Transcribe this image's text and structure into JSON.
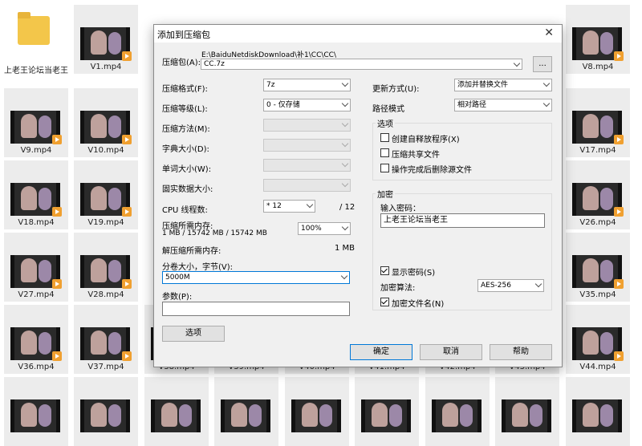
{
  "files": {
    "folder": "上老王论坛当老王",
    "videos": [
      "V1.mp4",
      "V8.mp4",
      "V9.mp4",
      "V10.mp4",
      "V17.mp4",
      "V18.mp4",
      "V19.mp4",
      "V26.mp4",
      "V27.mp4",
      "V28.mp4",
      "V35.mp4",
      "V36.mp4",
      "V37.mp4",
      "V38.mp4",
      "V39.mp4",
      "V40.mp4",
      "V41.mp4",
      "V42.mp4",
      "V43.mp4",
      "V44.mp4"
    ]
  },
  "dialog": {
    "title": "添加到压缩包",
    "archive_label": "压缩包(A):",
    "archive_path": "E:\\BaiduNetdiskDownload\\补1\\CC\\CC\\",
    "archive_name": "CC.7z",
    "browse_label": "...",
    "format_label": "压缩格式(F):",
    "format_value": "7z",
    "level_label": "压缩等级(L):",
    "level_value": "0 - 仅存储",
    "method_label": "压缩方法(M):",
    "dict_label": "字典大小(D):",
    "word_label": "单词大小(W):",
    "solid_label": "固实数据大小:",
    "threads_label": "CPU 线程数:",
    "threads_value": "* 12",
    "threads_max": "/ 12",
    "mem_comp_label": "压缩所需内存:",
    "mem_comp_value": "1 MB / 15742 MB / 15742 MB",
    "mem_percent": "100%",
    "mem_decomp_label": "解压缩所需内存:",
    "mem_decomp_value": "1 MB",
    "volume_label": "分卷大小，字节(V):",
    "volume_value": "5000M",
    "params_label": "参数(P):",
    "options_button": "选项",
    "update_label": "更新方式(U):",
    "update_value": "添加并替换文件",
    "path_label": "路径模式",
    "path_value": "相对路径",
    "options_group": "选项",
    "opt_sfx": "创建自释放程序(X)",
    "opt_shared": "压缩共享文件",
    "opt_delete": "操作完成后删除源文件",
    "encrypt_group": "加密",
    "password_label": "输入密码：",
    "password_value": "上老王论坛当老王",
    "show_password": "显示密码(S)",
    "enc_method_label": "加密算法:",
    "enc_method_value": "AES-256",
    "encrypt_names": "加密文件名(N)",
    "ok": "确定",
    "cancel": "取消",
    "help": "帮助"
  }
}
